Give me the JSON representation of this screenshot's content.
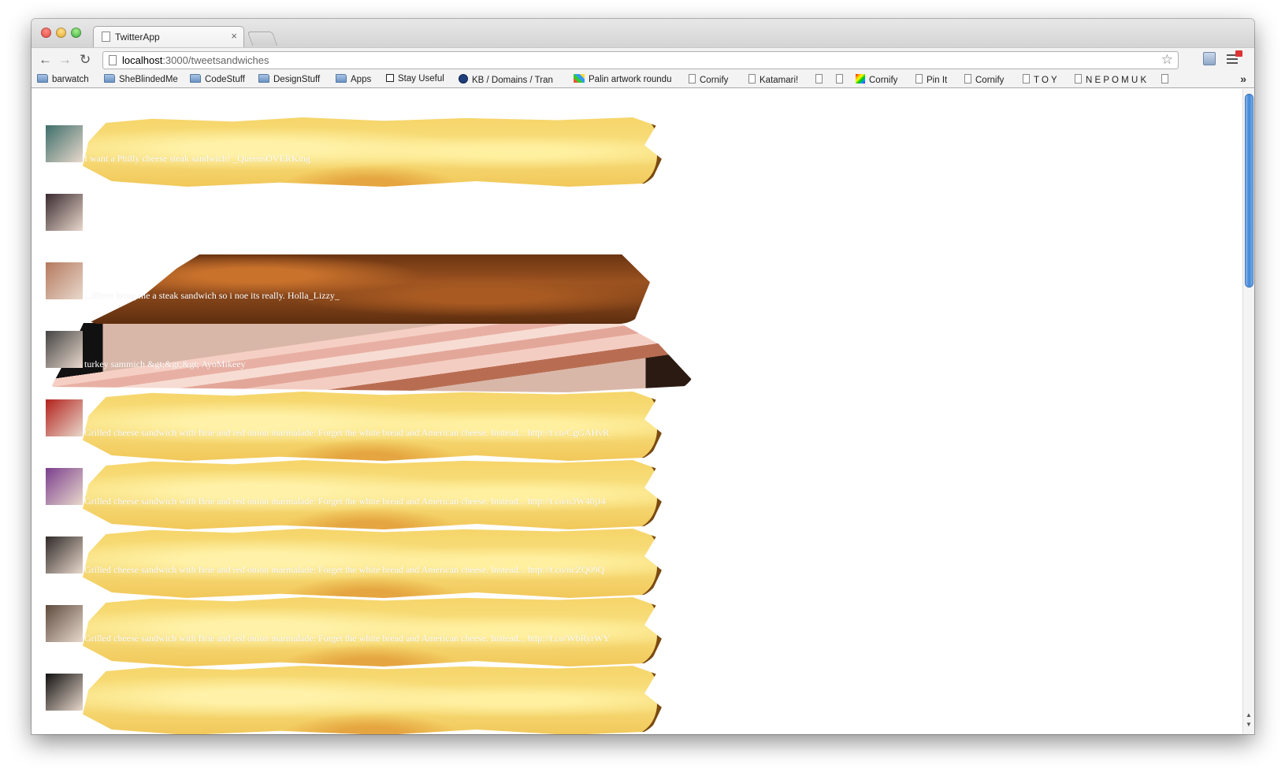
{
  "browser": {
    "tab_title": "TwitterApp",
    "tab_close": "×",
    "url_host": "localhost",
    "url_path": ":3000/tweetsandwiches",
    "nav": {
      "back": "←",
      "forward": "→",
      "reload": "↻"
    },
    "star": "☆"
  },
  "bookmarks": [
    {
      "label": "barwatch",
      "icon": "folder-icon"
    },
    {
      "label": "SheBlindedMe",
      "icon": "folder-icon"
    },
    {
      "label": "CodeStuff",
      "icon": "folder-icon"
    },
    {
      "label": "DesignStuff",
      "icon": "folder-icon"
    },
    {
      "label": "Apps",
      "icon": "folder-icon"
    },
    {
      "label": "Stay Useful",
      "icon": "checkbox-icon"
    },
    {
      "label": "KB / Domains / Tran",
      "icon": "moon-icon"
    },
    {
      "label": "Palin artwork roundu",
      "icon": "palin-icon"
    },
    {
      "label": "Cornify",
      "icon": "page-icon"
    },
    {
      "label": "Katamari!",
      "icon": "page-icon"
    },
    {
      "label": "",
      "icon": "page-icon"
    },
    {
      "label": "",
      "icon": "page-icon"
    },
    {
      "label": "Cornify",
      "icon": "rainbow-icon"
    },
    {
      "label": "Pin It",
      "icon": "page-icon"
    },
    {
      "label": "Cornify",
      "icon": "page-icon"
    },
    {
      "label": "T O Y",
      "icon": "page-icon"
    },
    {
      "label": "N E P O M U K",
      "icon": "page-icon"
    },
    {
      "label": "",
      "icon": "page-icon"
    }
  ],
  "bookmarks_more": "»",
  "tweets": [
    {
      "text": "I want a Philly cheese steak sandwich!  _QueensOVERKing",
      "sandwich": "cheese",
      "avatar_color": "#3d6f6a"
    },
    {
      "text": "",
      "sandwich": "none",
      "avatar_color": "#3a2a30"
    },
    {
      "text": "...ifferrr bring me a steak sandwich so i noe its really. Holla_Lizzy_",
      "sandwich": "steak",
      "avatar_color": "#b47a5e"
    },
    {
      "text": "turkey sammich &gt;&gt;&gt;  AyoMikeey",
      "sandwich": "turkey",
      "avatar_color": "#444444"
    },
    {
      "text": "Grilled cheese sandwich with Brie and red onion marmalade: Forget the white bread and American cheese. Instead... http://t.co/CgGAHvR",
      "sandwich": "cheese",
      "avatar_color": "#b2221c"
    },
    {
      "text": "Grilled cheese sandwich with Brie and red onion marmalade: Forget the white bread and American cheese. Instead... http://t.co/n3W40jJ4",
      "sandwich": "cheese",
      "avatar_color": "#7b3f8d"
    },
    {
      "text": "Grilled cheese sandwich with Brie and red onion marmalade: Forget the white bread and American cheese. Instead... http://t.co/ncZQ09Q",
      "sandwich": "cheese",
      "avatar_color": "#2f2a28"
    },
    {
      "text": "Grilled cheese sandwich with Brie and red onion marmalade: Forget the white bread and American cheese. Instead... http://t.co/WbRyrWY",
      "sandwich": "cheese",
      "avatar_color": "#5d4c3e"
    },
    {
      "text": "",
      "sandwich": "cheese",
      "avatar_color": "#111111"
    }
  ]
}
